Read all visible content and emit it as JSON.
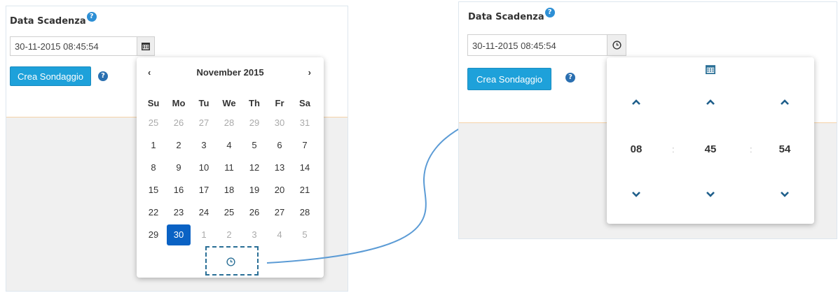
{
  "field": {
    "label": "Data Scadenza",
    "help_symbol": "?",
    "value": "30-11-2015 08:45:54"
  },
  "button": {
    "label": "Crea Sondaggio"
  },
  "calendar": {
    "prev": "‹",
    "next": "›",
    "month_title": "November 2015",
    "weekdays": [
      "Su",
      "Mo",
      "Tu",
      "We",
      "Th",
      "Fr",
      "Sa"
    ],
    "weeks": [
      [
        {
          "d": "25",
          "s": "old"
        },
        {
          "d": "26",
          "s": "old"
        },
        {
          "d": "27",
          "s": "old"
        },
        {
          "d": "28",
          "s": "old"
        },
        {
          "d": "29",
          "s": "old"
        },
        {
          "d": "30",
          "s": "old"
        },
        {
          "d": "31",
          "s": "old"
        }
      ],
      [
        {
          "d": "1"
        },
        {
          "d": "2"
        },
        {
          "d": "3"
        },
        {
          "d": "4"
        },
        {
          "d": "5"
        },
        {
          "d": "6"
        },
        {
          "d": "7"
        }
      ],
      [
        {
          "d": "8"
        },
        {
          "d": "9"
        },
        {
          "d": "10"
        },
        {
          "d": "11"
        },
        {
          "d": "12"
        },
        {
          "d": "13"
        },
        {
          "d": "14"
        }
      ],
      [
        {
          "d": "15"
        },
        {
          "d": "16"
        },
        {
          "d": "17"
        },
        {
          "d": "18"
        },
        {
          "d": "19"
        },
        {
          "d": "20"
        },
        {
          "d": "21"
        }
      ],
      [
        {
          "d": "22"
        },
        {
          "d": "23"
        },
        {
          "d": "24"
        },
        {
          "d": "25"
        },
        {
          "d": "26"
        },
        {
          "d": "27"
        },
        {
          "d": "28"
        }
      ],
      [
        {
          "d": "29"
        },
        {
          "d": "30",
          "s": "active"
        },
        {
          "d": "1",
          "s": "old"
        },
        {
          "d": "2",
          "s": "old"
        },
        {
          "d": "3",
          "s": "old"
        },
        {
          "d": "4",
          "s": "old"
        },
        {
          "d": "5",
          "s": "old"
        }
      ]
    ]
  },
  "time": {
    "hours": "08",
    "minutes": "45",
    "seconds": "54",
    "separator": ":"
  },
  "icons": {
    "calendar": "calendar-icon",
    "clock": "clock-icon",
    "up": "chevron-up-icon",
    "down": "chevron-down-icon",
    "help": "question-circle-icon"
  },
  "colors": {
    "accent": "#1ea1da",
    "selected_day": "#0a62c4",
    "arrow": "#5b9bd5",
    "chevron": "#1f5f8b"
  }
}
